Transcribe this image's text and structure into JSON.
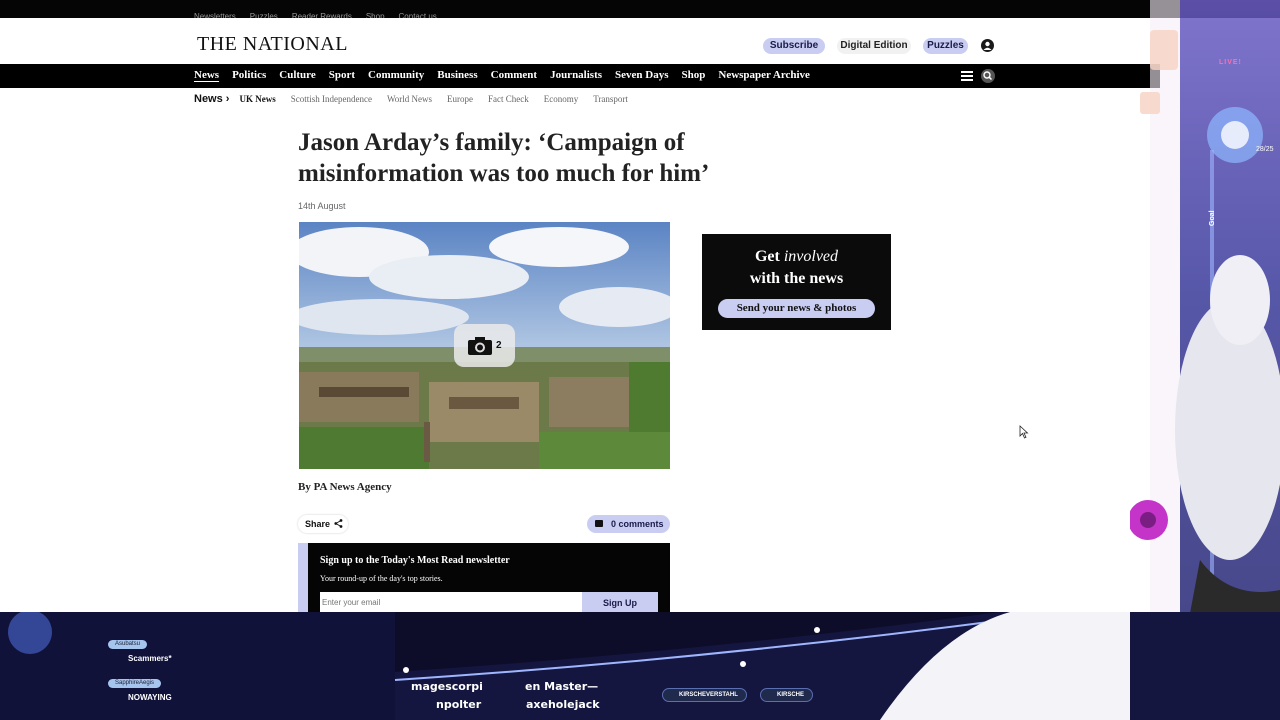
{
  "utility_links": [
    "Newsletters",
    "Puzzles",
    "Reader Rewards",
    "Shop",
    "Contact us"
  ],
  "masthead": {
    "logo_text": "THE NATIONAL",
    "subscribe": "Subscribe",
    "digital_edition": "Digital Edition",
    "puzzles": "Puzzles",
    "account_icon": "user-icon"
  },
  "main_nav": [
    "News",
    "Politics",
    "Culture",
    "Sport",
    "Community",
    "Business",
    "Comment",
    "Journalists",
    "Seven Days",
    "Shop",
    "Newspaper Archive"
  ],
  "sub_nav": {
    "section": "News",
    "items": [
      "UK News",
      "Scottish Independence",
      "World News",
      "Europe",
      "Fact Check",
      "Economy",
      "Transport"
    ]
  },
  "article": {
    "headline": "Jason Arday’s family: ‘Campaign of misinformation was too much for him’",
    "date": "14th August",
    "photo_count": "2",
    "byline": "By PA News Agency",
    "share_label": "Share",
    "comments_label": "0 comments"
  },
  "newsletter": {
    "title": "Sign up to the Today's Most Read newsletter",
    "subtitle": "Your round-up of the day's top stories.",
    "email_placeholder": "Enter your email",
    "signup_label": "Sign Up"
  },
  "promo": {
    "get": "Get ",
    "involved": "involved",
    "line2": "with the news",
    "cta": "Send your news & photos"
  },
  "overlay": {
    "live": "LIVE!",
    "counter": "28/25",
    "goal": "Goal",
    "chat": [
      {
        "user": "Asubatsu",
        "message": "Scammers*"
      },
      {
        "user": "SapphireAegis",
        "message": "NOWAYING"
      }
    ],
    "ticker": [
      "magescorpi",
      "en Master—",
      "npolter",
      "axeholejack"
    ],
    "socials": [
      "KIRSCHEVERSTAHL",
      "KIRSCHE"
    ]
  },
  "colors": {
    "accent": "#c9cdf2",
    "nav_bg": "#000000",
    "promo_bg": "#0b0b0b"
  }
}
